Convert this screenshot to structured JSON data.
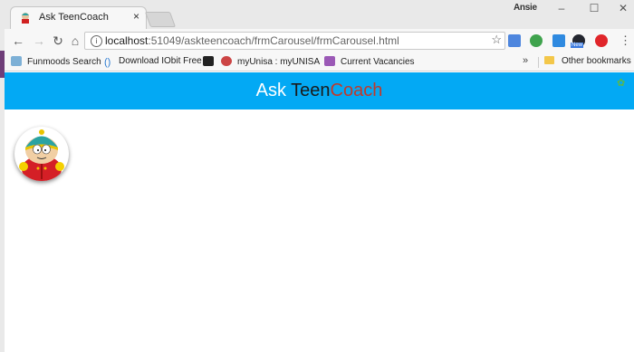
{
  "window": {
    "user_name": "Ansie"
  },
  "tab": {
    "title": "Ask TeenCoach",
    "close_glyph": "×"
  },
  "address_bar": {
    "host": "localhost",
    "path": ":51049/askteencoach/frmCarousel/frmCarousel.html"
  },
  "bookmarks": {
    "items": [
      {
        "label": "Funmoods Search"
      },
      {
        "label": "Download IObit Free"
      },
      {
        "label": ""
      },
      {
        "label": "myUnisa : myUNISA"
      },
      {
        "label": "Current Vacancies"
      }
    ],
    "more": "»",
    "other": "Other bookmarks"
  },
  "page": {
    "brand": {
      "ask": "Ask ",
      "teen": "Teen",
      "coach": "Coach"
    },
    "colors": {
      "header": "#03a9f4",
      "ask": "#ffffff",
      "teen": "#1a1a1a",
      "coach": "#c0392b"
    }
  }
}
